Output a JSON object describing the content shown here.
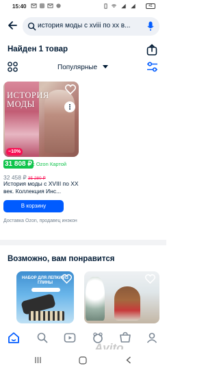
{
  "status_bar": {
    "time": "15:40",
    "battery": "41"
  },
  "search": {
    "query": "история моды с xviii по xx в..."
  },
  "results": {
    "found_label": "Найден 1 товар",
    "sort_label": "Популярные"
  },
  "product": {
    "cover_title": "ИСТОРИЯ МОДЫ",
    "discount": "−10%",
    "price_with_card": "31 808 ₽",
    "card_label": "с Ozon Картой",
    "price": "32 458 ₽",
    "old_price": "35 280 ₽",
    "title": "История моды с XVIII по XX век. Коллекция Инс...",
    "cart_button": "В корзину",
    "delivery": "Доставка Ozon, продавец инэкон"
  },
  "recommendations": {
    "title": "Возможно, вам понравится",
    "items": [
      {
        "image_text": "НАБОР ДЛЯ ЛЕПКИ ИЗ ГЛИНЫ"
      },
      {
        "image_text": ""
      }
    ]
  },
  "watermark": "Avito",
  "colors": {
    "accent": "#005bff",
    "green": "#10c44c",
    "red": "#f91155"
  },
  "icons": [
    "back-arrow-icon",
    "search-icon",
    "mic-icon",
    "share-icon",
    "grid-view-icon",
    "filter-sliders-icon",
    "heart-icon",
    "more-dots-icon",
    "home-icon",
    "catalog-icon",
    "video-icon",
    "fresh-icon",
    "cart-icon",
    "favorites-icon",
    "profile-icon"
  ]
}
